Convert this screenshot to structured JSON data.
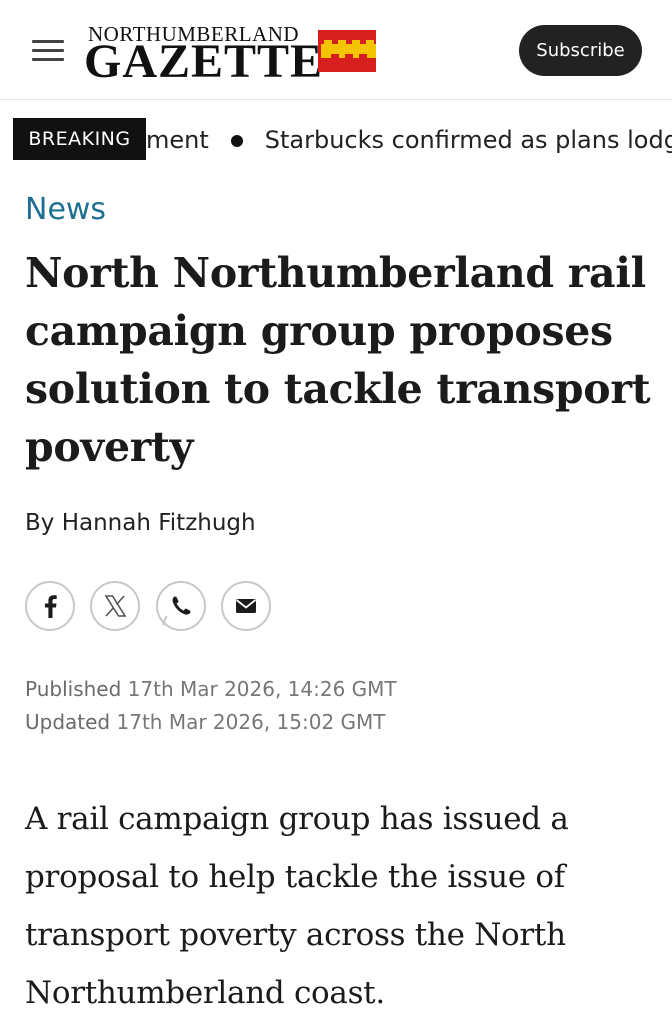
{
  "header": {
    "logo_line1": "NORTHUMBERLAND",
    "logo_line2": "GAZETTE",
    "subscribe_label": "Subscribe",
    "flag_colors": [
      "#d61f1f",
      "#f5c400"
    ]
  },
  "ticker": {
    "badge": "BREAKING",
    "item_fragment": "ment",
    "item_next": "Starbucks confirmed as plans lodg"
  },
  "article": {
    "section": "News",
    "headline": "North Northumberland rail campaign group proposes solution to tackle transport poverty",
    "byline_prefix": "By",
    "author": "Hannah Fitzhugh",
    "share_icons": [
      "facebook-icon",
      "x-icon",
      "whatsapp-icon",
      "email-icon"
    ],
    "published_label": "Published",
    "published_value": "17th Mar 2026, 14:26 GMT",
    "updated_label": "Updated",
    "updated_value": "17th Mar 2026, 15:02 GMT",
    "standfirst": "A rail campaign group has issued a proposal to help tackle the issue of transport poverty across the North Northumberland coast."
  },
  "colors": {
    "accent": "#1f6f93",
    "breaking_bg": "#111111",
    "subscribe_bg": "#222222"
  }
}
